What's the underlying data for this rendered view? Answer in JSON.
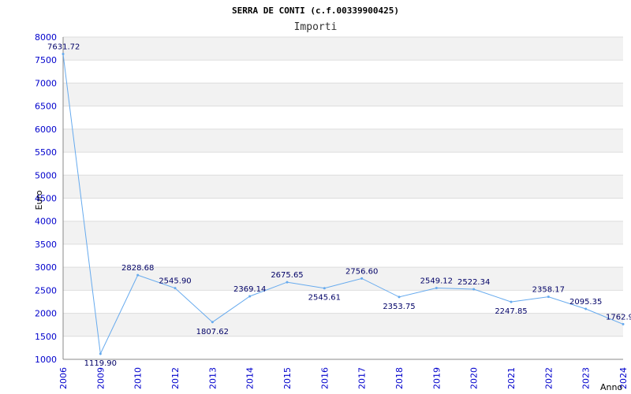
{
  "colors": {
    "band_alt": "#f2f2f2",
    "band_base": "#ffffff",
    "gridline": "#dddddd",
    "series_line": "#66aaee",
    "tick_text": "#0000cc",
    "data_label_text": "#000066",
    "axis_line": "#888888"
  },
  "chart_data": {
    "type": "line",
    "title": "SERRA DE CONTI (c.f.00339900425)",
    "subtitle": "Importi",
    "xlabel": "Anno",
    "ylabel": "Euro",
    "ylim": [
      1000,
      8000
    ],
    "yticks": [
      1000,
      1500,
      2000,
      2500,
      3000,
      3500,
      4000,
      4500,
      5000,
      5500,
      6000,
      6500,
      7000,
      7500,
      8000
    ],
    "grid": true,
    "legend": "none",
    "categories": [
      "2006",
      "2009",
      "2010",
      "2012",
      "2013",
      "2014",
      "2015",
      "2016",
      "2017",
      "2018",
      "2019",
      "2020",
      "2021",
      "2022",
      "2023",
      "2024"
    ],
    "values": [
      7631.72,
      1119.9,
      2828.68,
      2545.9,
      1807.62,
      2369.14,
      2675.65,
      2545.61,
      2756.6,
      2353.75,
      2549.12,
      2522.34,
      2247.85,
      2358.17,
      2095.35,
      1762.9
    ],
    "data_labels": [
      "7631.72",
      "1119.90",
      "2828.68",
      "2545.90",
      "1807.62",
      "2369.14",
      "2675.65",
      "2545.61",
      "2756.60",
      "2353.75",
      "2549.12",
      "2522.34",
      "2247.85",
      "2358.17",
      "2095.35",
      "1762.9"
    ]
  }
}
